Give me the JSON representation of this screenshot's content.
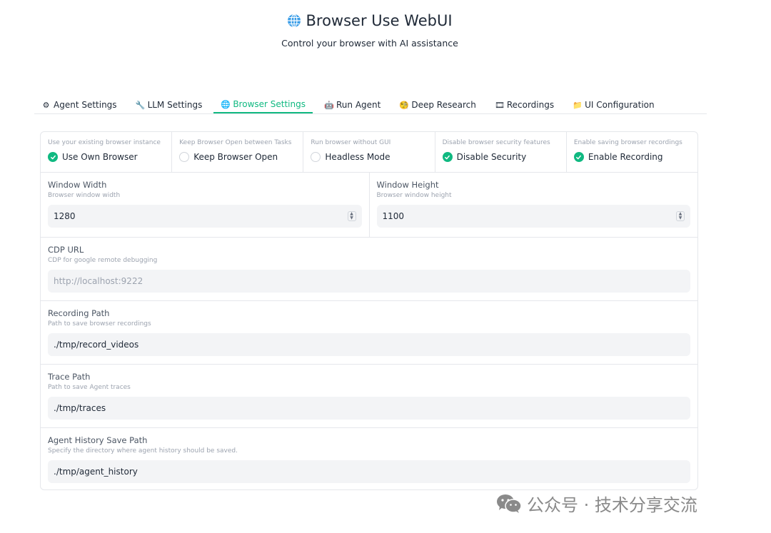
{
  "header": {
    "title": "Browser Use WebUI",
    "subtitle": "Control your browser with AI assistance"
  },
  "tabs": [
    {
      "label": "Agent Settings",
      "icon": "gear-icon",
      "glyph": "⚙"
    },
    {
      "label": "LLM Settings",
      "icon": "wrench-icon",
      "glyph": "🔧"
    },
    {
      "label": "Browser Settings",
      "icon": "globe-icon",
      "glyph": "🌐"
    },
    {
      "label": "Run Agent",
      "icon": "robot-icon",
      "glyph": "🤖"
    },
    {
      "label": "Deep Research",
      "icon": "magnifier-icon",
      "glyph": "🧐"
    },
    {
      "label": "Recordings",
      "icon": "film-icon",
      "glyph": "🎞"
    },
    {
      "label": "UI Configuration",
      "icon": "folder-icon",
      "glyph": "📁"
    }
  ],
  "active_tab": "Browser Settings",
  "checkboxes": [
    {
      "info": "Use your existing browser instance",
      "label": "Use Own Browser",
      "checked": true
    },
    {
      "info": "Keep Browser Open between Tasks",
      "label": "Keep Browser Open",
      "checked": false
    },
    {
      "info": "Run browser without GUI",
      "label": "Headless Mode",
      "checked": false
    },
    {
      "info": "Disable browser security features",
      "label": "Disable Security",
      "checked": true
    },
    {
      "info": "Enable saving browser recordings",
      "label": "Enable Recording",
      "checked": true
    }
  ],
  "window_width": {
    "label": "Window Width",
    "info": "Browser window width",
    "value": "1280"
  },
  "window_height": {
    "label": "Window Height",
    "info": "Browser window height",
    "value": "1100"
  },
  "cdp_url": {
    "label": "CDP URL",
    "info": "CDP for google remote debugging",
    "placeholder": "http://localhost:9222"
  },
  "recording_path": {
    "label": "Recording Path",
    "info": "Path to save browser recordings",
    "value": "./tmp/record_videos"
  },
  "trace_path": {
    "label": "Trace Path",
    "info": "Path to save Agent traces",
    "value": "./tmp/traces"
  },
  "agent_history_path": {
    "label": "Agent History Save Path",
    "info": "Specify the directory where agent history should be saved.",
    "value": "./tmp/agent_history"
  },
  "watermark": {
    "text": "公众号 · 技术分享交流"
  },
  "colors": {
    "accent": "#10b981",
    "border": "#e5e7eb",
    "input_bg": "#f3f4f6",
    "muted": "#9ca3af"
  }
}
